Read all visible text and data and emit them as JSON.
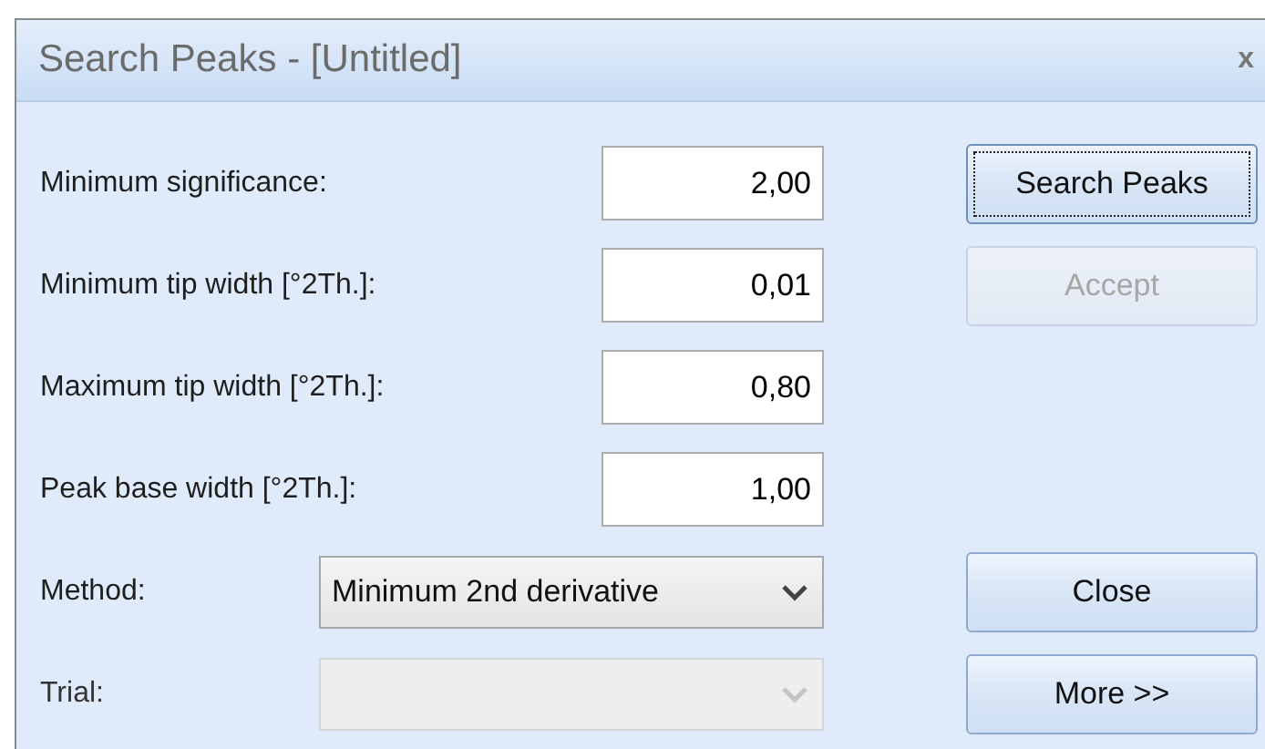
{
  "window": {
    "title": "Search Peaks - [Untitled]",
    "close": "x"
  },
  "rows": [
    {
      "kind": "field",
      "label": "Minimum significance:",
      "value": "2,00"
    },
    {
      "kind": "field",
      "label": "Minimum tip width [°2Th.]:",
      "value": "0,01"
    },
    {
      "kind": "field",
      "label": "Maximum tip width [°2Th.]:",
      "value": "0,80"
    },
    {
      "kind": "field",
      "label": "Peak base width [°2Th.]:",
      "value": "1,00"
    },
    {
      "kind": "combo",
      "label": "Method:",
      "value": "Minimum 2nd derivative",
      "disabled": false
    },
    {
      "kind": "combo",
      "label": "Trial:",
      "disabled": true
    }
  ],
  "top_buttons": [
    {
      "label": "Search Peaks",
      "disabled": false,
      "focused": true
    },
    {
      "label": "Accept",
      "disabled": true,
      "focused": false
    }
  ],
  "bottom_buttons": [
    {
      "label": "Close",
      "disabled": false,
      "focused": false
    },
    {
      "label": "More >>",
      "disabled": false,
      "focused": false
    }
  ]
}
